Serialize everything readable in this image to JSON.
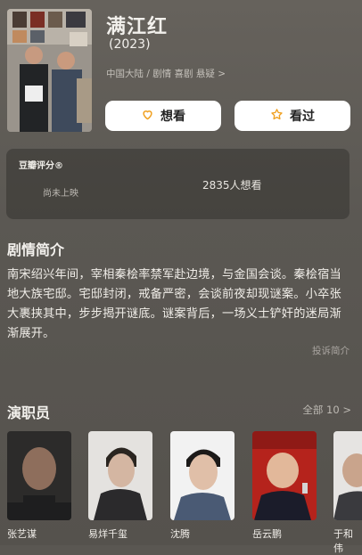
{
  "movie": {
    "title": "满江红",
    "year": "(2023)",
    "meta": "中国大陆 / 剧情 喜剧 悬疑 >"
  },
  "actions": {
    "want_label": "想看",
    "seen_label": "看过"
  },
  "rating": {
    "title": "豆瓣评分®",
    "status": "尚未上映",
    "want_count": "2835人想看"
  },
  "synopsis": {
    "heading": "剧情简介",
    "text": "南宋绍兴年间，宰相秦桧率禁军赴边境，与金国会谈。秦桧宿当地大族宅邸。宅邸封闭，戒备严密，会谈前夜却现谜案。小卒张大裹挟其中，步步揭开谜底。谜案背后，一场义士铲奸的迷局渐渐展开。",
    "report_label": "投诉简介"
  },
  "cast": {
    "heading": "演职员",
    "all_label": "全部 10 >",
    "members": [
      {
        "name": "张艺谋"
      },
      {
        "name": "易烊千玺"
      },
      {
        "name": "沈腾"
      },
      {
        "name": "岳云鹏"
      },
      {
        "name": "于和伟"
      }
    ]
  },
  "colors": {
    "background": "#5a5752",
    "button_bg": "#ffffff",
    "accent_icon": "#f0a020"
  },
  "icons": {
    "want": "heart-outline-icon",
    "seen": "star-outline-icon"
  }
}
